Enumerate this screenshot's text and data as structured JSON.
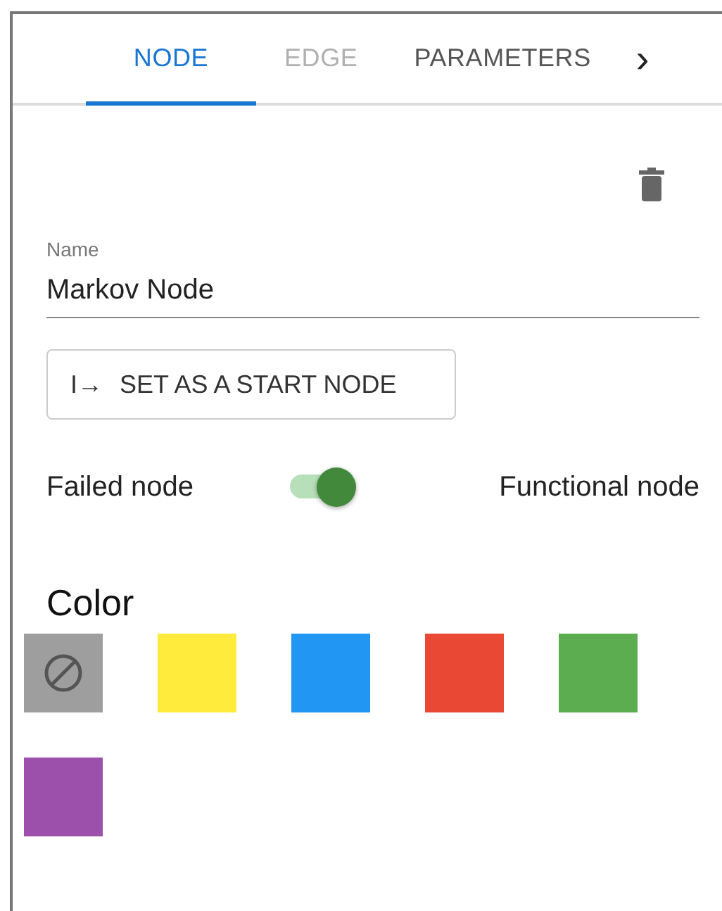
{
  "tabs": [
    {
      "label": "NODE",
      "selected": true,
      "disabled": false
    },
    {
      "label": "EDGE",
      "selected": false,
      "disabled": true
    },
    {
      "label": "PARAMETERS",
      "selected": false,
      "disabled": false
    }
  ],
  "tab_scroll": "›",
  "name_field": {
    "label": "Name",
    "value": "Markov Node"
  },
  "start_button": {
    "icon": "I→",
    "label": "SET AS A START NODE"
  },
  "state_switch": {
    "off_label": "Failed node",
    "on_label": "Functional node",
    "on": true
  },
  "color_section": {
    "title": "Color",
    "swatches": [
      {
        "kind": "none",
        "color": "#9e9e9e"
      },
      {
        "kind": "color",
        "color": "#ffeb3b"
      },
      {
        "kind": "color",
        "color": "#2196f3"
      },
      {
        "kind": "color",
        "color": "#e94834"
      },
      {
        "kind": "color",
        "color": "#5cad4f"
      },
      {
        "kind": "color",
        "color": "#9c4fab"
      }
    ]
  }
}
